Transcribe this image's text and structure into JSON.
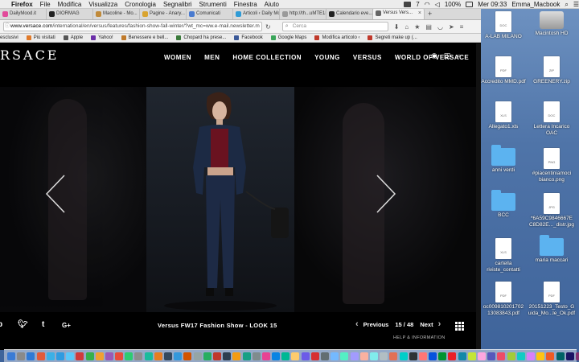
{
  "menubar": {
    "app": "Firefox",
    "items": [
      "File",
      "Modifica",
      "Visualizza",
      "Cronologia",
      "Segnalibri",
      "Strumenti",
      "Finestra",
      "Aiuto"
    ],
    "status": {
      "badge": "7",
      "battery": "100%",
      "clock": "Mer 09:33",
      "user": "Emma_Macbook"
    }
  },
  "tabs": [
    {
      "label": "DailyMood.it",
      "color": "#e24a9a"
    },
    {
      "label": "DIORMAG",
      "color": "#222222"
    },
    {
      "label": "Macoline - Mo...",
      "color": "#c08a3a"
    },
    {
      "label": "Pagine - Anary...",
      "color": "#d9a430"
    },
    {
      "label": "Comunicati",
      "color": "#4a7bd0"
    },
    {
      "label": "Articoli ‹ Daily Moo...",
      "color": "#2f9bd6"
    },
    {
      "label": "http://th...uMTE1LjA",
      "color": "#9a9a9a"
    },
    {
      "label": "Calendario eve...",
      "color": "#222222"
    },
    {
      "label": "Versus Vers...",
      "color": "#666666",
      "active": true
    }
  ],
  "toolbar": {
    "url_host": "www.versace.com",
    "url_path": "/international/en/versus/features/fashion-show-fall-winter/?wt_mc=ww.e-mail.newsletter.m",
    "search_placeholder": "Cerca"
  },
  "bookmarks": [
    {
      "label": "esclusivi"
    },
    {
      "label": "Più visitati",
      "color": "#e07a2a"
    },
    {
      "label": "Apple",
      "color": "#555555"
    },
    {
      "label": "Yahoo!",
      "color": "#6b2fa8"
    },
    {
      "label": "Benessere e bell...",
      "color": "#c07a2a"
    },
    {
      "label": "Chopard ha prese...",
      "color": "#3a7a3a"
    },
    {
      "label": "Facebook",
      "color": "#3b5998"
    },
    {
      "label": "Google Maps",
      "color": "#3aa65a"
    },
    {
      "label": "Modifica articolo ‹",
      "color": "#c0392b"
    },
    {
      "label": "Segreti make up (...",
      "color": "#c0392b"
    }
  ],
  "site": {
    "logo": "RSACE",
    "nav": [
      "WOMEN",
      "MEN",
      "HOME COLLECTION",
      "YOUNG",
      "VERSUS",
      "WORLD OF VERSACE"
    ],
    "caption": "Versus FW17 Fashion Show - LOOK 15",
    "pager": {
      "prev": "Previous",
      "current": "15",
      "total": "48",
      "position_text": "15 / 48",
      "next": "Next"
    },
    "help": "HELP & INFORMATION",
    "social": {
      "twitter": "𝑡w",
      "tumblr": "t",
      "gplus": "G+"
    }
  },
  "desktop_icons": [
    {
      "label": "A-LAB MILANO",
      "kind": "doc",
      "tag": "DOC"
    },
    {
      "label": "Macintosh HD",
      "kind": "hdd"
    },
    {
      "label": "Accredito MMD.pdf",
      "kind": "doc",
      "tag": "PDF"
    },
    {
      "label": "GREENERY.zip",
      "kind": "doc",
      "tag": "ZIP"
    },
    {
      "label": "Allegato1.xls",
      "kind": "doc",
      "tag": "XLS"
    },
    {
      "label": "Lettera Incarico OAC",
      "kind": "doc",
      "tag": "DOC"
    },
    {
      "label": "anni verdi",
      "kind": "folder"
    },
    {
      "label": "#piacentiniamoci bianco.png",
      "kind": "doc",
      "tag": "PNG"
    },
    {
      "label": "BCC",
      "kind": "folder"
    },
    {
      "label": "*6A59C9846667E C8D82E..._distr.jpg",
      "kind": "doc",
      "tag": "JPG"
    },
    {
      "label": "cartella riviste_contatti",
      "kind": "doc",
      "tag": "XLS"
    },
    {
      "label": "maria maccari",
      "kind": "folder"
    },
    {
      "label": "oc009810201702 13083843.pdf",
      "kind": "doc",
      "tag": "PDF"
    },
    {
      "label": "20151223_Testo_G uida_Mo...le_Ok.pdf",
      "kind": "doc",
      "tag": "PDF"
    }
  ],
  "dock_colors": [
    "#3a7bd5",
    "#8a8a8a",
    "#2f7ad6",
    "#e25b3a",
    "#3bb0e6",
    "#2f9be0",
    "#5ac8fa",
    "#d03a3a",
    "#35b04a",
    "#f0a030",
    "#9b59b6",
    "#e74c3c",
    "#2ecc71",
    "#8e8e8e",
    "#1abc9c",
    "#e67e22",
    "#34495e",
    "#3498db",
    "#d35400",
    "#95a5a6",
    "#27ae60",
    "#c0392b",
    "#2c3e50",
    "#f39c12",
    "#16a085",
    "#7f8c8d",
    "#e84393",
    "#0984e3",
    "#00b894",
    "#fdcb6e",
    "#6c5ce7",
    "#d63031",
    "#636e72",
    "#74b9ff",
    "#55efc4",
    "#a29bfe",
    "#fab1a0",
    "#81ecec",
    "#b2bec3",
    "#e17055",
    "#00cec9",
    "#2d3436",
    "#ff7675",
    "#0652dd",
    "#009432",
    "#ea2027",
    "#1289a7",
    "#c4e538",
    "#fda7df",
    "#5758bb",
    "#ed4c67",
    "#a3cb38",
    "#12cbc4",
    "#d980fa",
    "#ffc312",
    "#ee5a24",
    "#006266",
    "#1b1464",
    "#833471",
    "#6f1e51"
  ]
}
